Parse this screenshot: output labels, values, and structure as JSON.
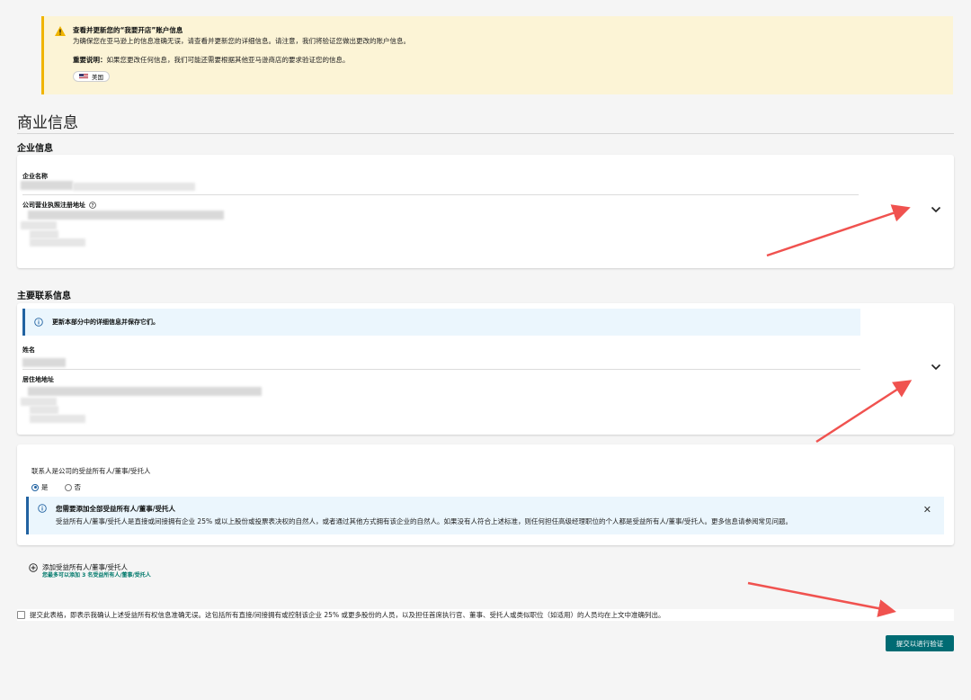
{
  "notice": {
    "title": "查看并更新您的“我要开店”账户信息",
    "subtitle": "为确保您在亚马逊上的信息准确无误，请查看并更新您的详细信息。请注意，我们将验证您做出更改的账户信息。",
    "important_label": "重要说明：",
    "important_text": "如果您更改任何信息，我们可能还需要根据其他亚马逊商店的要求验证您的信息。",
    "country": "美国"
  },
  "page": {
    "title": "商业信息"
  },
  "business": {
    "heading": "企业信息",
    "company_name_label": "企业名称",
    "address_label": "公司营业执照注册地址"
  },
  "contact": {
    "heading": "主要联系信息",
    "info": "更新本部分中的详细信息并保存它们。",
    "name_label": "姓名",
    "address_label": "居住地地址"
  },
  "beneficial": {
    "question": "联系人是公司的受益所有人/董事/受托人",
    "yes": "是",
    "no": "否",
    "selected": "是",
    "info_title": "您需要添加全部受益所有人/董事/受托人",
    "info_text": "受益所有人/董事/受托人是直接或间接拥有企业 25% 或以上股份或投票表决权的自然人，或者通过其他方式拥有该企业的自然人。如果没有人符合上述标准，则任何担任高级经理职位的个人都是受益所有人/董事/受托人。更多信息请参阅常见问题。",
    "add_label": "添加受益所有人/董事/受托人",
    "add_note": "您最多可以添加 3 名受益所有人/董事/受托人"
  },
  "confirm": {
    "text": "提交此表格，即表示我确认上述受益所有权信息准确无误。这包括所有直接/间接拥有或控制该企业 25% 或更多股份的人员，以及担任首席执行官、董事、受托人或类似职位（如适用）的人员均在上文中准确列出。"
  },
  "submit": {
    "label": "提交以进行验证"
  },
  "colors": {
    "accent": "#006b73",
    "warning_bg": "#fcf4d6",
    "info_bg": "#ebf6fd",
    "annotation_arrow": "#f0524f"
  },
  "icons": [
    "warning-icon",
    "flag-us-icon",
    "help-circle-icon",
    "chevron-down-icon",
    "info-icon",
    "close-icon",
    "plus-circle-icon"
  ]
}
